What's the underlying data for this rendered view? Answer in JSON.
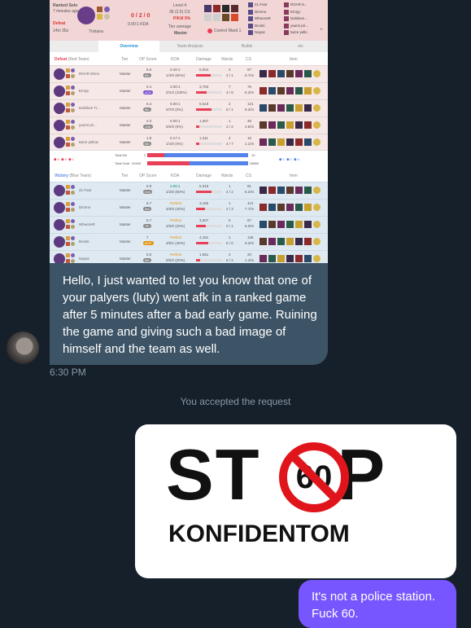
{
  "opgg": {
    "queue": "Ranked Solo",
    "ago": "7 minutes ago",
    "result_label": "Defeat",
    "duration": "14m 35s",
    "champion_name": "Tristana",
    "player_kda": "0 / 2 / 0",
    "player_kda_ratio": "0.00:1 KDA",
    "level_label": "Level 4",
    "cs_label": "36 (2.5) CS",
    "pkill_label": "P/Kill 0%",
    "tier_avg_label": "Tier average",
    "tier_avg_value": "Master",
    "ward_label": "Control Ward 1",
    "tabs": [
      "Overview",
      "Team Analysis",
      "Builds",
      "etc"
    ],
    "red_team": {
      "result": "Defeat",
      "name": "(Red Team)",
      "columns": [
        "Tier",
        "OP Score",
        "KDA",
        "Damage",
        "Wards",
        "CS",
        "Item"
      ],
      "players": [
        {
          "name": "ROAR 8Oox",
          "tier": "Master",
          "score": "5.5",
          "rank": "5th",
          "kda_ratio": "0.20:1",
          "kda": "1/4/0 (50%)",
          "damage": "5,004",
          "dmg_pct": 0.55,
          "wards": "2",
          "wards2": "3 / 1",
          "cs": "97",
          "cs_min": "6.7/m"
        },
        {
          "name": "Emiyy",
          "tier": "Master",
          "score": "6.4",
          "rank": "ACE",
          "kda_ratio": "3.00:1",
          "kda": "0/1/2 (100%)",
          "damage": "3,793",
          "dmg_pct": 0.42,
          "wards": "7",
          "wards2": "3 / 8",
          "cs": "76",
          "cs_min": "5.3/m"
        },
        {
          "name": "Dalislum Tr...",
          "tier": "Master",
          "score": "6.4",
          "rank": "5th",
          "kda_ratio": "0.00:1",
          "kda": "0/7/0 (0%)",
          "damage": "5,519",
          "dmg_pct": 0.6,
          "wards": "2",
          "wards2": "5 / 1",
          "cs": "121",
          "cs_min": "8.3/m"
        },
        {
          "name": "yaumi pri...",
          "tier": "Master",
          "score": "2.0",
          "rank": "10th",
          "kda_ratio": "0.00:1",
          "kda": "0/2/0 (0%)",
          "damage": "1,067",
          "dmg_pct": 0.12,
          "wards": "1",
          "wards2": "2 / 2",
          "cs": "36",
          "cs_min": "2.5/m"
        },
        {
          "name": "twice yellow",
          "tier": "Master",
          "score": "1.8",
          "rank": "9th",
          "kda_ratio": "0.17:1",
          "kda": "1/1/0 (0%)",
          "damage": "1,311",
          "dmg_pct": 0.14,
          "wards": "4",
          "wards2": "4 / 7",
          "cs": "16",
          "cs_min": "1.1/m"
        }
      ]
    },
    "totals": {
      "red_icons": [
        "0",
        "0",
        "1"
      ],
      "blue_icons": [
        "1",
        "1",
        "0"
      ],
      "kill_label": "Total Kill",
      "gold_label": "Total Gold",
      "red_kill": "2",
      "blue_kill": "10",
      "red_gold": "20440",
      "blue_gold": "28650",
      "kill_ratio": 0.17,
      "gold_ratio": 0.42
    },
    "blue_team": {
      "result": "Victory",
      "name": "(Blue Team)",
      "columns": [
        "Tier",
        "OP Score",
        "KDA",
        "Damage",
        "Wards",
        "CS",
        "Item"
      ],
      "players": [
        {
          "name": "21 Fear",
          "tier": "Master",
          "score": "6.9",
          "rank": "2nd",
          "kda_ratio": "3.00:1",
          "kda": "1/2/5 (60%)",
          "damage": "5,316",
          "dmg_pct": 0.58,
          "wards": "1",
          "wards2": "4 / 2",
          "cs": "91",
          "cs_min": "6.2/m"
        },
        {
          "name": "Dimmo",
          "tier": "Master",
          "score": "6.7",
          "rank": "3rd",
          "kda_ratio": "Perfect",
          "kda": "4/0/0 (40%)",
          "damage": "3,165",
          "dmg_pct": 0.35,
          "wards": "1",
          "wards2": "2 / 3",
          "cs": "113",
          "cs_min": "7.7/m"
        },
        {
          "name": "WheezeR",
          "tier": "Master",
          "score": "5.7",
          "rank": "7th",
          "kda_ratio": "Perfect",
          "kda": "2/0/0 (20%)",
          "damage": "3,307",
          "dmg_pct": 0.36,
          "wards": "0",
          "wards2": "0 / 1",
          "cs": "87",
          "cs_min": "6.0/m"
        },
        {
          "name": "Broski",
          "tier": "Master",
          "score": "7",
          "rank": "MVP",
          "kda_ratio": "Perfect",
          "kda": "3/0/1 (40%)",
          "damage": "4,181",
          "dmg_pct": 0.46,
          "wards": "1",
          "wards2": "5 / 0",
          "cs": "136",
          "cs_min": "9.3/m"
        },
        {
          "name": "Nayas",
          "tier": "Master",
          "score": "5.5",
          "rank": "5th",
          "kda_ratio": "Perfect",
          "kda": "0/0/2 (20%)",
          "damage": "1,551",
          "dmg_pct": 0.17,
          "wards": "4",
          "wards2": "6 / 2",
          "cs": "20",
          "cs_min": "1.4/m"
        }
      ]
    },
    "opponents_top": [
      "21 Fear",
      "Dimmo",
      "WheezeR",
      "Broski",
      "Nayas"
    ],
    "allies_top": [
      "ROAR 8...",
      "Emiyy",
      "Dalislum...",
      "yaumi pri...",
      "twice yello"
    ]
  },
  "incoming_message": "Hello, I just wanted to let you know that one of your palyers (luty) went afk in a ranked game after 5 minutes after a bad early game. Ruining the game and giving such a bad image of himself and the team as well.",
  "incoming_time": "6:30 PM",
  "system_notice": "You accepted the request",
  "stop_image": {
    "word_left": "ST",
    "word_right": "P",
    "sign_number": "60",
    "subtitle": "KONFIDENTOM"
  },
  "outgoing_message": "It's not a police station. Fuck 60.",
  "colors": {
    "background": "#15202b",
    "incoming_bubble": "#3d5466",
    "outgoing_bubble": "#7856ff",
    "muted_text": "#8b98a5",
    "stop_red": "#e0151b"
  }
}
